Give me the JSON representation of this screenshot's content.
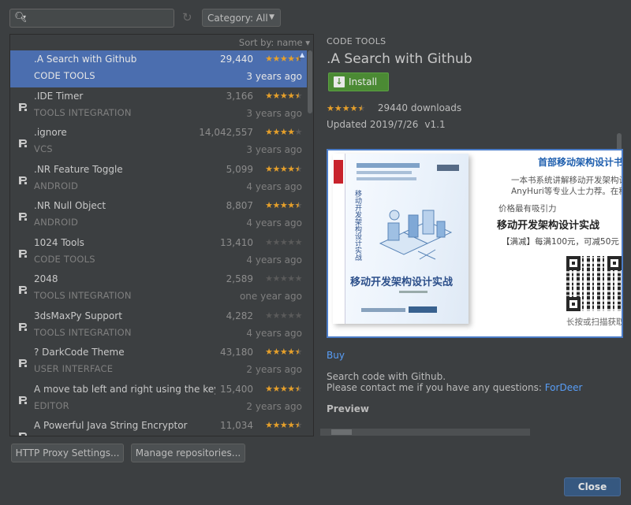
{
  "toolbar": {
    "search_value": "",
    "category_label": "Category: All"
  },
  "list": {
    "sort_label": "Sort by: name",
    "plugins": [
      {
        "name": ".A Search with Github",
        "category": "CODE TOOLS",
        "downloads": "29,440",
        "rating": 4.5,
        "age": "3 years ago",
        "selected": true
      },
      {
        "name": ".IDE Timer",
        "category": "TOOLS INTEGRATION",
        "downloads": "3,166",
        "rating": 4.5,
        "age": "3 years ago"
      },
      {
        "name": ".ignore",
        "category": "VCS",
        "downloads": "14,042,557",
        "rating": 4,
        "age": "3 years ago"
      },
      {
        "name": ".NR Feature Toggle",
        "category": "ANDROID",
        "downloads": "5,099",
        "rating": 4.5,
        "age": "4 years ago"
      },
      {
        "name": ".NR Null Object",
        "category": "ANDROID",
        "downloads": "8,807",
        "rating": 4.5,
        "age": "4 years ago"
      },
      {
        "name": "1024 Tools",
        "category": "CODE TOOLS",
        "downloads": "13,410",
        "rating": 0,
        "age": "4 years ago"
      },
      {
        "name": "2048",
        "category": "TOOLS INTEGRATION",
        "downloads": "2,589",
        "rating": 0,
        "age": "one year ago"
      },
      {
        "name": "3dsMaxPy Support",
        "category": "TOOLS INTEGRATION",
        "downloads": "4,282",
        "rating": 0,
        "age": "4 years ago"
      },
      {
        "name": "? DarkCode Theme",
        "category": "USER INTERFACE",
        "downloads": "43,180",
        "rating": 4.5,
        "age": "2 years ago"
      },
      {
        "name": "A move tab left and right using the keybo",
        "category": "EDITOR",
        "downloads": "15,400",
        "rating": 4.5,
        "age": "2 years ago"
      },
      {
        "name": "A Powerful Java String Encryptor",
        "category": "",
        "downloads": "11,034",
        "rating": 4.5,
        "age": ""
      }
    ]
  },
  "buttons": {
    "proxy": "HTTP Proxy Settings...",
    "repos": "Manage repositories...",
    "close": "Close"
  },
  "detail": {
    "category": "CODE TOOLS",
    "title": ".A Search with Github",
    "install_label": "Install",
    "rating": 4.5,
    "downloads": "29440 downloads",
    "updated": "Updated 2019/7/26",
    "version": "v1.1",
    "buy_label": "Buy",
    "description_line1": "Search code with Github.",
    "description_line2": "Please contact me if you have any questions:",
    "contact_link": "ForDeer",
    "preview_heading": "Preview",
    "ad": {
      "heading": "首部移动架构设计书籍",
      "line1": "一本书系统讲解移动开发架构设计，作者是",
      "line2": "AnyHuri等专业人士力荐。在移动架构开",
      "line3": "价格最有吸引力",
      "big": "移动开发架构设计实战",
      "line4": "【满减】每满100元，可减50元",
      "book_title": "移动开发架构设计实战",
      "book_vertical": "移动开发架构设计实战",
      "qr_caption": "长按或扫描获取"
    }
  },
  "colors": {
    "accent": "#4b6eaf",
    "star": "#e6a02b",
    "install": "#4b8a34",
    "link": "#589df6"
  },
  "icons": {
    "search": "search-icon",
    "refresh": "refresh-icon",
    "plugin": "plugin-icon",
    "download": "download-icon"
  }
}
